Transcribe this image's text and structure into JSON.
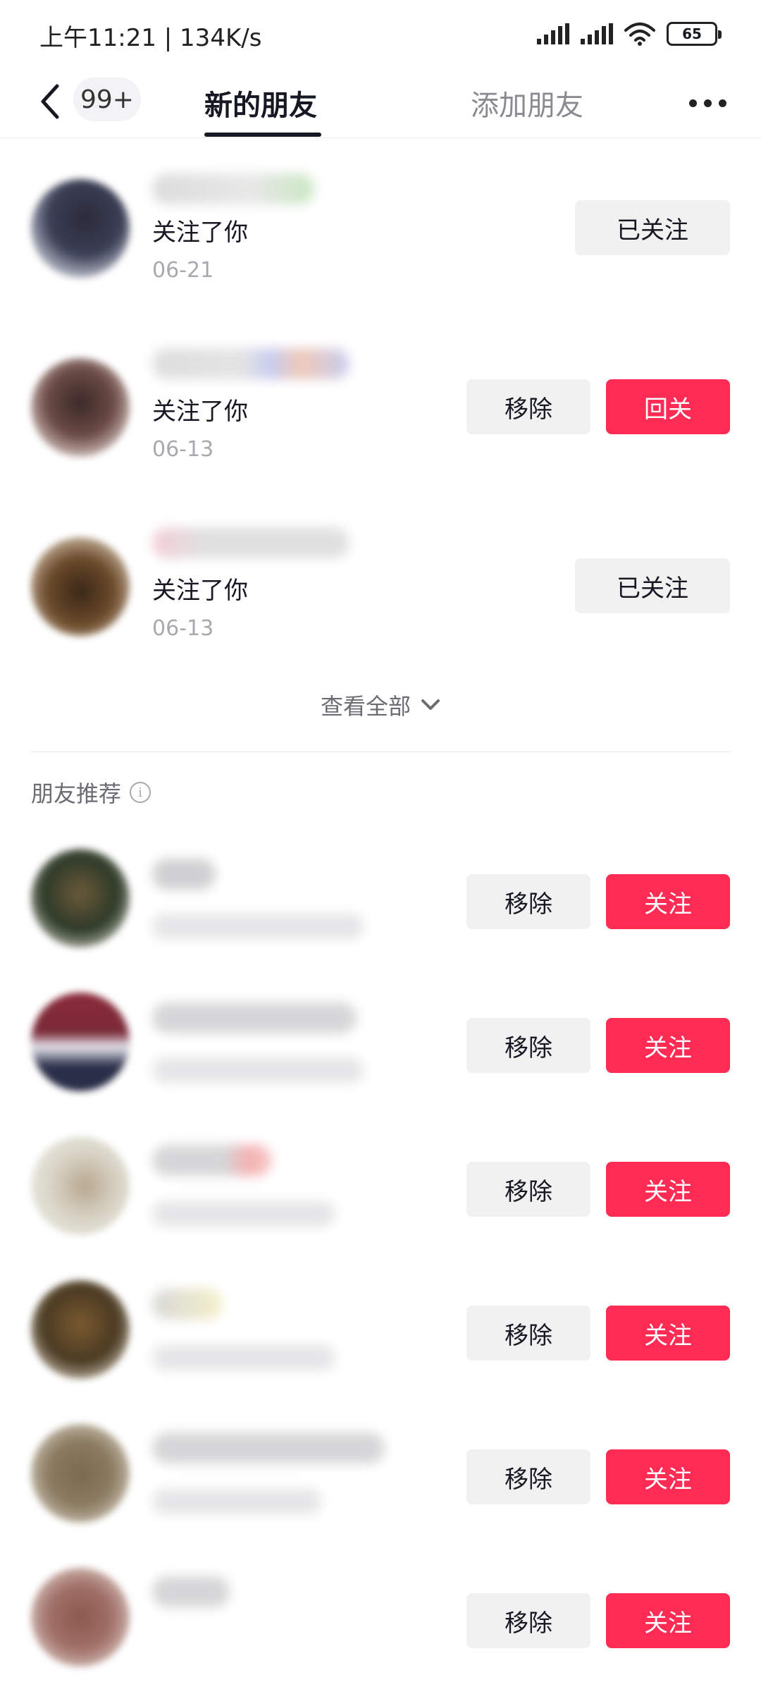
{
  "status_bar": {
    "time": "上午11:21 | 134K/s",
    "battery": "65",
    "icons": [
      "signal-icon",
      "signal-icon",
      "wifi-icon",
      "battery-icon"
    ]
  },
  "nav": {
    "badge": "99+",
    "tabs": [
      {
        "label": "新的朋友",
        "active": true
      },
      {
        "label": "添加朋友",
        "active": false
      }
    ]
  },
  "new_friends": [
    {
      "action": "关注了你",
      "date": "06-21",
      "buttons": [
        "已关注"
      ]
    },
    {
      "action": "关注了你",
      "date": "06-13",
      "buttons": [
        "移除",
        "回关"
      ]
    },
    {
      "action": "关注了你",
      "date": "06-13",
      "buttons": [
        "已关注"
      ]
    }
  ],
  "view_all": "查看全部",
  "recommend_title": "朋友推荐",
  "recommendations": [
    {
      "buttons": [
        "移除",
        "关注"
      ]
    },
    {
      "buttons": [
        "移除",
        "关注"
      ]
    },
    {
      "buttons": [
        "移除",
        "关注"
      ]
    },
    {
      "buttons": [
        "移除",
        "关注"
      ]
    },
    {
      "buttons": [
        "移除",
        "关注"
      ]
    },
    {
      "buttons": [
        "移除",
        "关注"
      ]
    }
  ],
  "colors": {
    "accent": "#fe2c55",
    "button_gray": "#f1f1f2",
    "text_primary": "#161823",
    "text_secondary": "#a8a9ad"
  }
}
